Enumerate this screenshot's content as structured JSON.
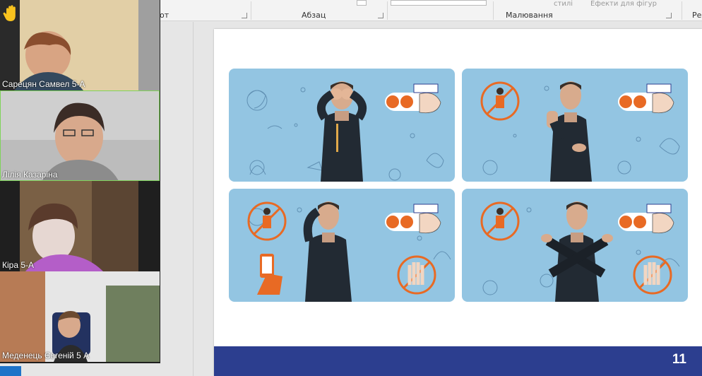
{
  "ribbon": {
    "font_group_label_tail": "от",
    "paragraph_group_label": "Абзац",
    "drawing_group_label": "Малювання",
    "styles_label": "стилі",
    "shape_effects_label": "Ефекти для фігур",
    "editing_label_tail": "Ре"
  },
  "slide": {
    "page_number": "11",
    "footer_color": "#2c3e8f",
    "panel_color": "#93c5e2",
    "accent_color": "#e86a24"
  },
  "participants": [
    {
      "name": "Сарецян Самвел 5-А",
      "raised_hand": true,
      "active_speaker": false
    },
    {
      "name": "Лілія Казаріна",
      "raised_hand": false,
      "active_speaker": true
    },
    {
      "name": "Кіра 5-А",
      "raised_hand": false,
      "active_speaker": false
    },
    {
      "name": "Меденець Євгеній 5 А",
      "raised_hand": false,
      "active_speaker": false
    }
  ],
  "icons": {
    "raised_hand": "raised-hand-icon"
  }
}
